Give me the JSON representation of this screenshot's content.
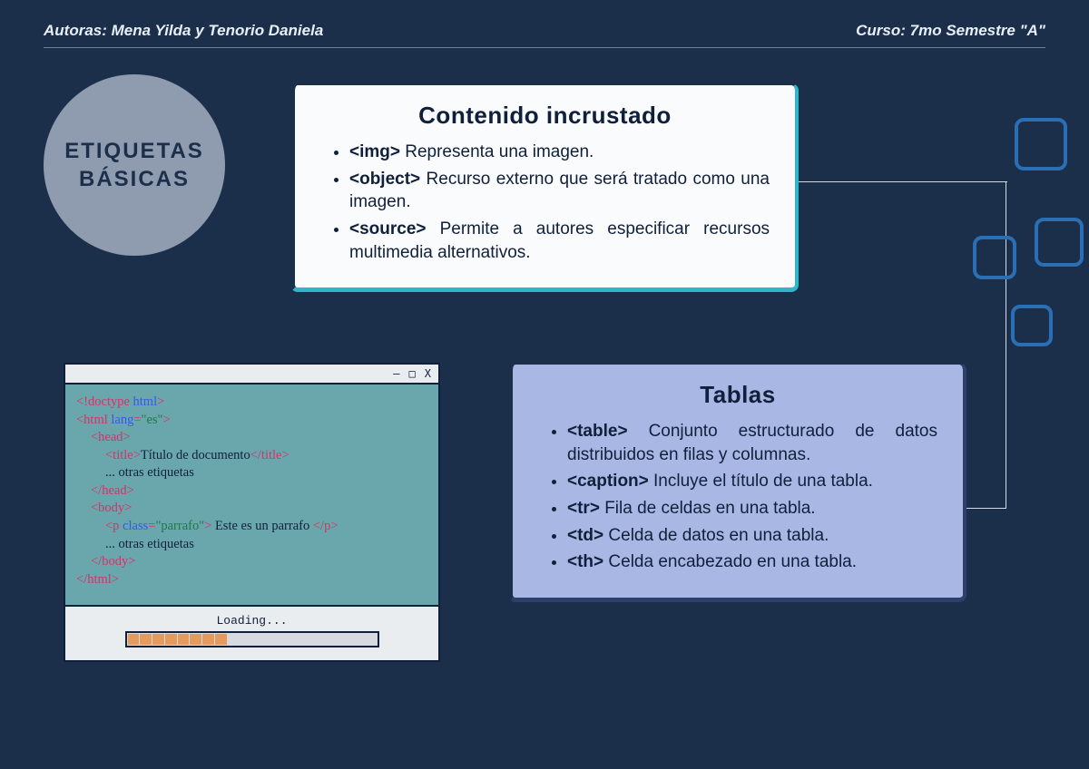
{
  "header": {
    "authors": "Autoras: Mena Yilda y Tenorio Daniela",
    "course": "Curso: 7mo Semestre \"A\""
  },
  "badge": {
    "line1": "ETIQUETAS",
    "line2": "BÁSICAS"
  },
  "contenido": {
    "title": "Contenido incrustado",
    "items": [
      {
        "tag": "<img>",
        "desc": "Representa una imagen."
      },
      {
        "tag": "<object>",
        "desc": "Recurso externo que será tratado como una imagen."
      },
      {
        "tag": "<source>",
        "desc": "Permite a autores especificar recursos multimedia alternativos."
      }
    ]
  },
  "tablas": {
    "title": "Tablas",
    "items": [
      {
        "tag": "<table>",
        "desc": "Conjunto estructurado de datos distribuidos en filas y columnas."
      },
      {
        "tag": "<caption>",
        "desc": "Incluye el título de una tabla."
      },
      {
        "tag": "<tr>",
        "desc": "Fila de celdas en una tabla."
      },
      {
        "tag": "<td>",
        "desc": "Celda de datos en una tabla."
      },
      {
        "tag": "<th>",
        "desc": "Celda encabezado en una tabla."
      }
    ]
  },
  "code_window": {
    "controls": {
      "min": "—",
      "max": "□",
      "close": "X"
    },
    "lines": [
      {
        "indent": 0,
        "parts": [
          {
            "cls": "t-red",
            "t": "<!doctype "
          },
          {
            "cls": "t-blue",
            "t": "html"
          },
          {
            "cls": "t-red",
            "t": ">"
          }
        ]
      },
      {
        "indent": 0,
        "parts": [
          {
            "cls": "t-red",
            "t": "<html "
          },
          {
            "cls": "t-blue",
            "t": "lang"
          },
          {
            "cls": "t-red",
            "t": "="
          },
          {
            "cls": "t-green",
            "t": "\"es\""
          },
          {
            "cls": "t-red",
            "t": ">"
          }
        ]
      },
      {
        "indent": 1,
        "parts": [
          {
            "cls": "t-red",
            "t": "<head>"
          }
        ]
      },
      {
        "indent": 2,
        "parts": [
          {
            "cls": "t-red",
            "t": "<title>"
          },
          {
            "cls": "t-black",
            "t": "Título de documento"
          },
          {
            "cls": "t-red",
            "t": "</title>"
          }
        ]
      },
      {
        "indent": 2,
        "parts": [
          {
            "cls": "t-black",
            "t": "... otras etiquetas"
          }
        ]
      },
      {
        "indent": 1,
        "parts": [
          {
            "cls": "t-red",
            "t": "</head>"
          }
        ]
      },
      {
        "indent": 1,
        "parts": [
          {
            "cls": "t-red",
            "t": "<body>"
          }
        ]
      },
      {
        "indent": 2,
        "parts": [
          {
            "cls": "t-red",
            "t": "<p "
          },
          {
            "cls": "t-blue",
            "t": "class"
          },
          {
            "cls": "t-red",
            "t": "="
          },
          {
            "cls": "t-green",
            "t": "\"parrafo\""
          },
          {
            "cls": "t-red",
            "t": "> "
          },
          {
            "cls": "t-black",
            "t": "Este es un parrafo "
          },
          {
            "cls": "t-red",
            "t": "</p>"
          }
        ]
      },
      {
        "indent": 2,
        "parts": [
          {
            "cls": "t-black",
            "t": "... otras etiquetas"
          }
        ]
      },
      {
        "indent": 1,
        "parts": [
          {
            "cls": "t-red",
            "t": "</body>"
          }
        ]
      },
      {
        "indent": 0,
        "parts": [
          {
            "cls": "t-red",
            "t": "</html>"
          }
        ]
      }
    ],
    "loading": "Loading...",
    "progress_filled": 8,
    "progress_total": 20
  }
}
